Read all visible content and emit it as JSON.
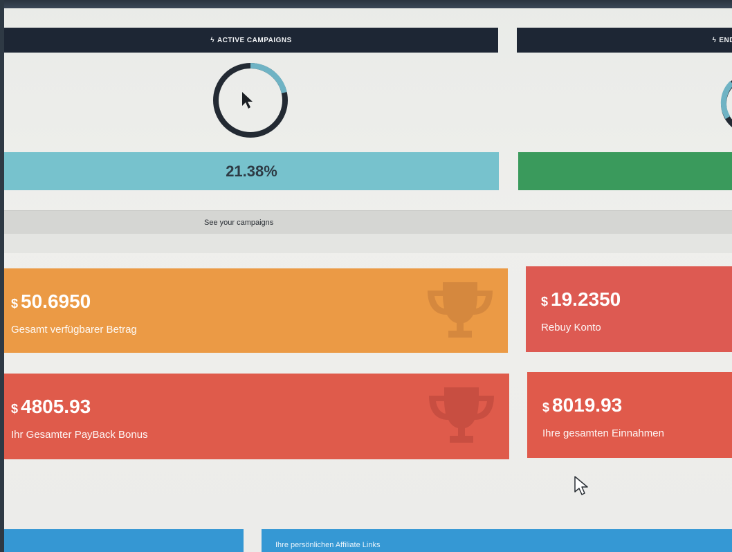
{
  "campaigns": {
    "active_header": "ACTIVE CAMPAIGNS",
    "ended_header": "END",
    "active_percent_text": "21.38%",
    "active_percent_value": 21.38,
    "see_campaigns_label": "See your campaigns"
  },
  "cards": {
    "total": {
      "currency": "$",
      "amount": "50.6950",
      "caption": "Gesamt verfügbarer Betrag"
    },
    "rebuy": {
      "currency": "$",
      "amount": "19.2350",
      "caption": "Rebuy Konto"
    },
    "payback": {
      "currency": "$",
      "amount": "4805.93",
      "caption": "Ihr Gesamter PayBack Bonus"
    },
    "earnings": {
      "currency": "$",
      "amount": "8019.93",
      "caption": "Ihre gesamten Einnahmen"
    }
  },
  "footer": {
    "affiliate_label": "Ihre persönlichen Affiliate Links"
  },
  "colors": {
    "header_bg": "#1d2634",
    "active_bar": "#77c2cd",
    "ended_bar": "#3a9a5c",
    "card_orange": "#eb9a45",
    "card_red": "#df5b4b",
    "footer_blue": "#3598d4"
  },
  "icons": {
    "header_bolt": "bolt-icon",
    "card_trophy": "trophy-icon",
    "pointer": "arrow-cursor-icon"
  }
}
